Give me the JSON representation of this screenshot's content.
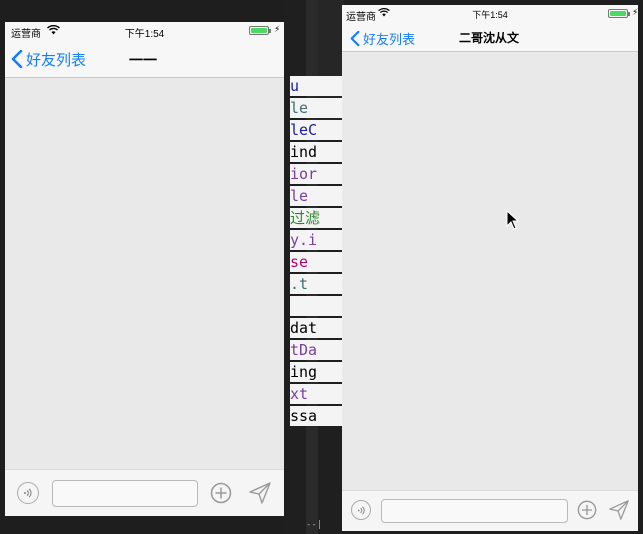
{
  "left_phone": {
    "status": {
      "carrier": "运营商",
      "time": "下午1:54"
    },
    "nav": {
      "back_label": "好友列表",
      "title": "一一"
    },
    "input": {
      "value": "",
      "placeholder": ""
    }
  },
  "right_phone": {
    "status": {
      "carrier": "运营商",
      "time": "下午1:54"
    },
    "nav": {
      "back_label": "好友列表",
      "title": "二哥沈从文"
    },
    "input": {
      "value": "",
      "placeholder": ""
    }
  },
  "ide_code_lines": [
    {
      "text": "u",
      "color": "#1a1aa6"
    },
    {
      "text": "le",
      "color": "#3f6e74"
    },
    {
      "text": "leC",
      "color": "#1a1aa6"
    },
    {
      "text": "ind",
      "color": "#000000"
    },
    {
      "text": "ior",
      "color": "#7a3e9d"
    },
    {
      "text": "le",
      "color": "#7a3e9d"
    },
    {
      "text": "过滤",
      "color": "#2a8a2a"
    },
    {
      "text": "y.i",
      "color": "#7a3e9d"
    },
    {
      "text": "se",
      "color": "#b5006e"
    },
    {
      "text": ".t",
      "color": "#3f6e74"
    },
    {
      "text": "",
      "color": "#000000"
    },
    {
      "text": "dat",
      "color": "#000000"
    },
    {
      "text": "tDa",
      "color": "#7a3e9d"
    },
    {
      "text": "ing",
      "color": "#000000"
    },
    {
      "text": "xt",
      "color": "#7a3e9d"
    },
    {
      "text": "ssa",
      "color": "#000000"
    }
  ],
  "ide_bottom_text": "--|"
}
